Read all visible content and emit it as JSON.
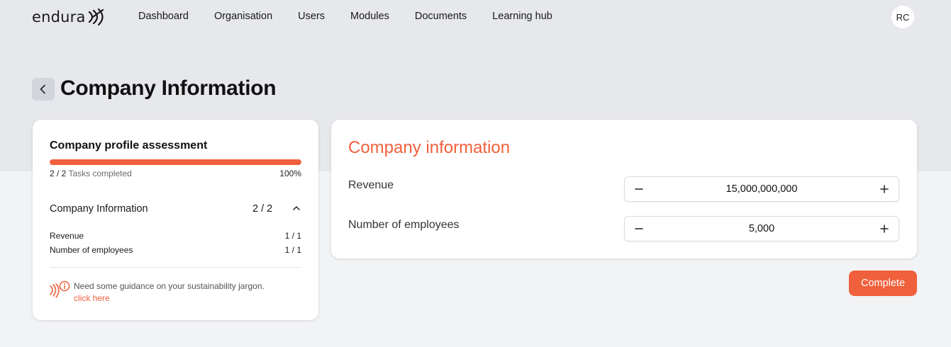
{
  "brand": {
    "name": "endura",
    "accent": "#f0603c"
  },
  "nav": {
    "links": [
      "Dashboard",
      "Organisation",
      "Users",
      "Modules",
      "Documents",
      "Learning hub"
    ],
    "avatar_initials": "RC"
  },
  "header": {
    "title": "Company Information"
  },
  "assessment": {
    "title": "Company profile assessment",
    "progress_fraction": 1.0,
    "tasks_done": "2 / 2",
    "tasks_label": "Tasks completed",
    "percent_label": "100%",
    "section": {
      "name": "Company Information",
      "count": "2 / 2"
    },
    "items": [
      {
        "label": "Revenue",
        "value": "1 / 1"
      },
      {
        "label": "Number of employees",
        "value": "1 / 1"
      }
    ],
    "guidance": {
      "text": "Need some guidance on your sustainability jargon.",
      "link": "click here"
    }
  },
  "form": {
    "title": "Company information",
    "fields": [
      {
        "label": "Revenue",
        "value": "15,000,000,000"
      },
      {
        "label": "Number of employees",
        "value": "5,000"
      }
    ],
    "complete_label": "Complete"
  }
}
